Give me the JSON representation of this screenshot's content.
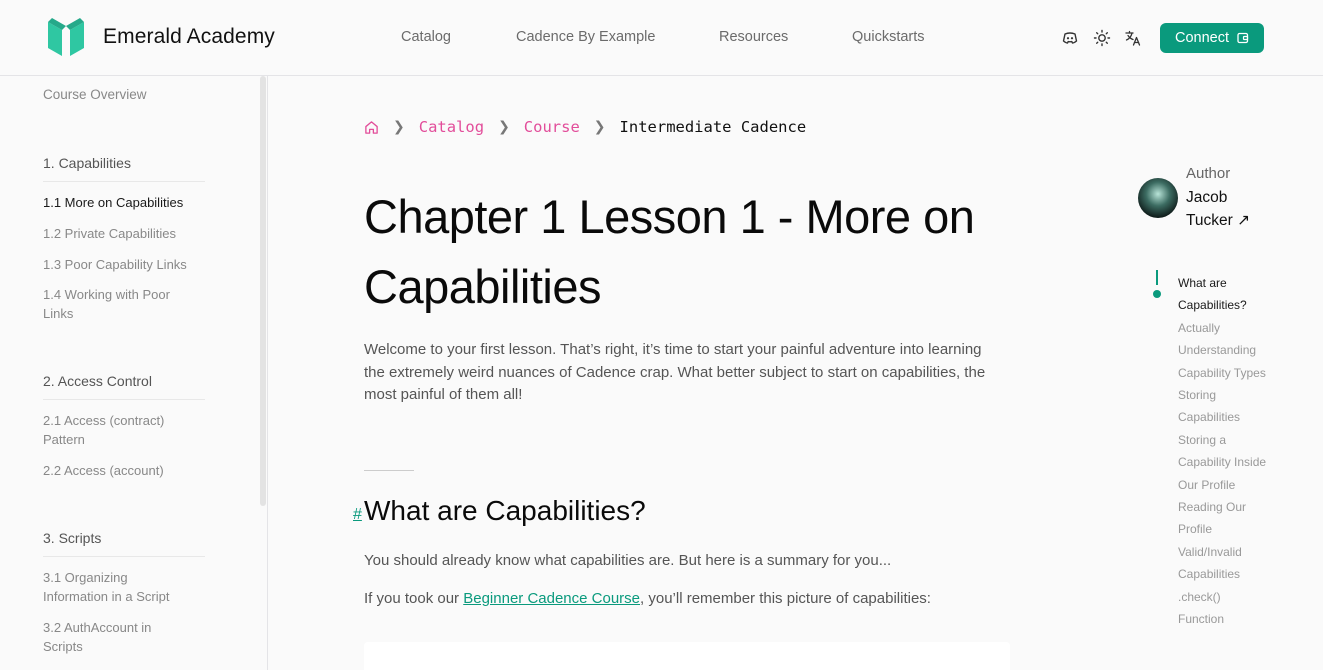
{
  "header": {
    "brand": "Emerald Academy",
    "nav": [
      "Catalog",
      "Cadence By Example",
      "Resources",
      "Quickstarts"
    ],
    "icons": [
      "discord-icon",
      "sun-icon",
      "translate-icon"
    ],
    "connect_label": "Connect",
    "accent": "#0a9a7d"
  },
  "sidebar": {
    "overview": "Course Overview",
    "sections": [
      {
        "title": "1. Capabilities",
        "items": [
          "1.1 More on Capabilities",
          "1.2 Private Capabilities",
          "1.3 Poor Capability Links",
          "1.4 Working with Poor Links"
        ]
      },
      {
        "title": "2. Access Control",
        "items": [
          "2.1 Access (contract) Pattern",
          "2.2 Access (account)"
        ]
      },
      {
        "title": "3. Scripts",
        "items": [
          "3.1 Organizing Information in a Script",
          "3.2 AuthAccount in Scripts"
        ]
      }
    ],
    "active_item": "1.1 More on Capabilities"
  },
  "breadcrumb": {
    "items": [
      "Catalog",
      "Course"
    ],
    "current": "Intermediate Cadence",
    "link_color": "#e24d9a"
  },
  "main": {
    "title": "Chapter 1 Lesson 1 - More on Capabilities",
    "intro": "Welcome to your first lesson. That’s right, it’s time to start your painful adventure into learning the extremely weird nuances of Cadence crap. What better subject to start on capabilities, the most painful of them all!",
    "anchor": "#",
    "h2": "What are Capabilities?",
    "para1": "You should already know what capabilities are. But here is a summary for you...",
    "para2_before": "If you took our ",
    "para2_link": "Beginner Cadence Course",
    "para2_after": ", you’ll remember this picture of capabilities:"
  },
  "author": {
    "label": "Author",
    "name": "Jacob Tucker ↗"
  },
  "toc": {
    "items": [
      "What are Capabilities?",
      "Actually Understanding Capability Types",
      "Storing Capabilities",
      "Storing a Capability Inside Our Profile",
      "Reading Our Profile",
      "Valid/Invalid Capabilities",
      ".check()",
      "Function"
    ],
    "active": 0
  }
}
